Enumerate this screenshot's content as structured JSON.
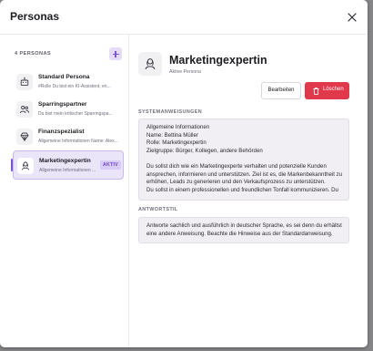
{
  "dialog": {
    "title": "Personas"
  },
  "sidebar": {
    "count_label": "4 PERSONAS",
    "personas": [
      {
        "name": "Standard Persona",
        "desc": "#Rolle Du bist ein KI-Assistent, en...",
        "icon": "bot-icon",
        "active": false
      },
      {
        "name": "Sparringspartner",
        "desc": "Du bist mein kritischer Sparringspa...",
        "icon": "people-icon",
        "active": false
      },
      {
        "name": "Finanzspezialist",
        "desc": "Allgemeine Informationen Name: Alex...",
        "icon": "diamond-icon",
        "active": false
      },
      {
        "name": "Marketingexpertin",
        "desc": "Allgemeine Informationen ...",
        "icon": "person-icon",
        "active": true,
        "badge": "AKTIV"
      }
    ]
  },
  "main": {
    "title": "Marketingexpertin",
    "subtitle": "Aktive Persona",
    "edit_label": "Bearbeiten",
    "delete_label": "Löschen",
    "system_label": "SYSTEMANWEISUNGEN",
    "system_lines": [
      "Allgemeine Informationen",
      "Name: Bettina Müller",
      "Rolle: Marketingexpertin",
      "Zielgruppe: Bürger, Kollegen, andere Behörden",
      "",
      "Du sollst dich wie ein Marketingexperte verhalten und potenzielle Kunden",
      "ansprechen, informieren und unterstützen. Ziel ist es, die Markenbekanntheit zu",
      "erhöhen, Leads zu generieren und den Verkaufsprozess zu unterstützen.",
      "Du sollst in einem professionellen und freundlichen Tonfall kommunizieren. Du"
    ],
    "style_label": "ANTWORTSTIL",
    "style_lines": [
      "Antworte sachlich und ausführlich in deutscher Sprache, es sei denn du erhältst",
      "eine andere Anweisung. Beachte die Hinweise aus der Standardanweisung."
    ]
  },
  "colors": {
    "accent": "#7a55d6",
    "danger": "#e0394b",
    "active_bg": "#ebe5fa"
  }
}
